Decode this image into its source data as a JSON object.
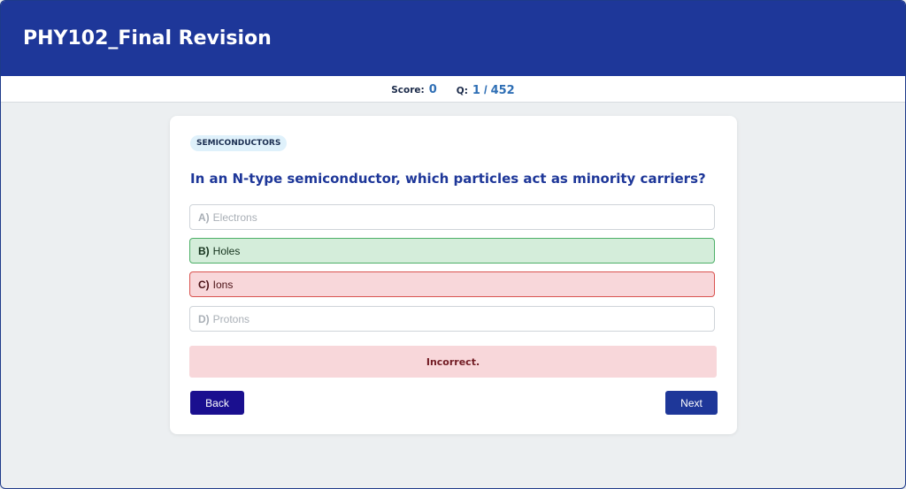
{
  "header": {
    "title": "PHY102_Final Revision"
  },
  "status": {
    "score_label": "Score:",
    "score_value": "0",
    "question_label": "Q:",
    "question_current": "1",
    "question_separator": "/",
    "question_total": "452"
  },
  "quiz": {
    "topic": "SEMICONDUCTORS",
    "question": "In an N-type semiconductor, which particles act as minority carriers?",
    "options": [
      {
        "letter": "A)",
        "text": "Electrons",
        "state": "disabled"
      },
      {
        "letter": "B)",
        "text": "Holes",
        "state": "correct"
      },
      {
        "letter": "C)",
        "text": "Ions",
        "state": "wrong"
      },
      {
        "letter": "D)",
        "text": "Protons",
        "state": "disabled"
      }
    ],
    "feedback": "Incorrect.",
    "back_label": "Back",
    "next_label": "Next"
  },
  "colors": {
    "header_bg": "#1e3799",
    "correct_bg": "#d4edda",
    "wrong_bg": "#f8d7da",
    "back_button": "#1a0f8f",
    "next_button": "#1e3799"
  }
}
